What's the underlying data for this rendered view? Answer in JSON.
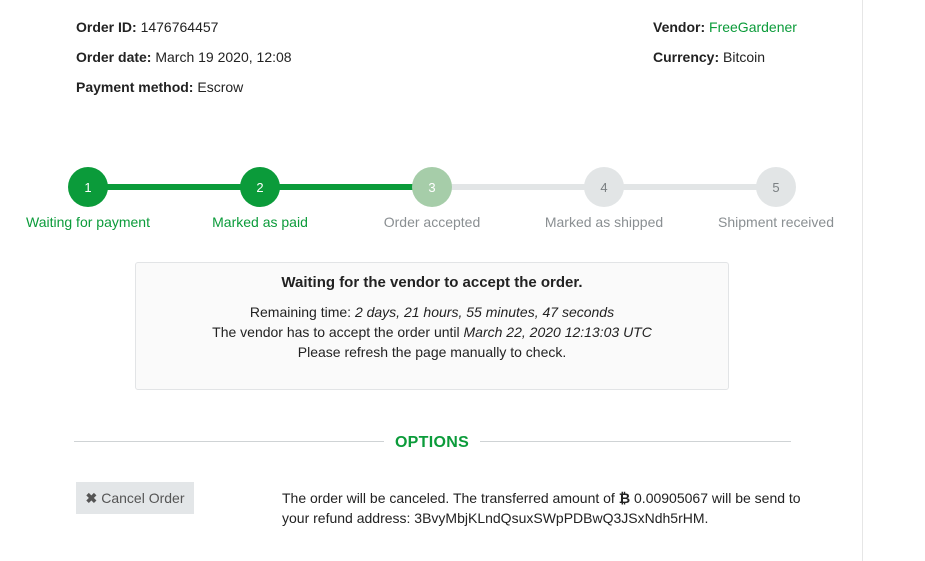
{
  "order": {
    "id_label": "Order ID:",
    "id_value": "1476764457",
    "date_label": "Order date:",
    "date_value": "March 19 2020, 12:08",
    "payment_label": "Payment method:",
    "payment_value": "Escrow",
    "vendor_label": "Vendor:",
    "vendor_value": "FreeGardener",
    "currency_label": "Currency:",
    "currency_value": "Bitcoin"
  },
  "colors": {
    "accent": "#0b9b3a",
    "current_step": "#a6cda9",
    "inactive_step": "#e2e5e6"
  },
  "steps": [
    {
      "number": "1",
      "label": "Waiting for payment",
      "state": "done"
    },
    {
      "number": "2",
      "label": "Marked as paid",
      "state": "done"
    },
    {
      "number": "3",
      "label": "Order accepted",
      "state": "current"
    },
    {
      "number": "4",
      "label": "Marked as shipped",
      "state": "todo"
    },
    {
      "number": "5",
      "label": "Shipment received",
      "state": "todo"
    }
  ],
  "notice": {
    "headline": "Waiting for the vendor to accept the order.",
    "remaining_label": "Remaining time:",
    "remaining_value": "2 days, 21 hours, 55 minutes, 47 seconds",
    "deadline_label": "The vendor has to accept the order until",
    "deadline_value": "March 22, 2020 12:13:03 UTC",
    "refresh_text": "Please refresh the page manually to check."
  },
  "options": {
    "title": "OPTIONS",
    "cancel_icon": "close-icon",
    "cancel_label": "Cancel Order",
    "cancel_text_part1": "The order will be canceled. The transferred amount of",
    "btc_symbol": "₿",
    "btc_amount": "0.00905067",
    "cancel_text_part2": "will be send to your refund address:",
    "refund_address": "3BvyMbjKLndQsuxSWpPDBwQ3JSxNdh5rHM",
    "period": "."
  }
}
